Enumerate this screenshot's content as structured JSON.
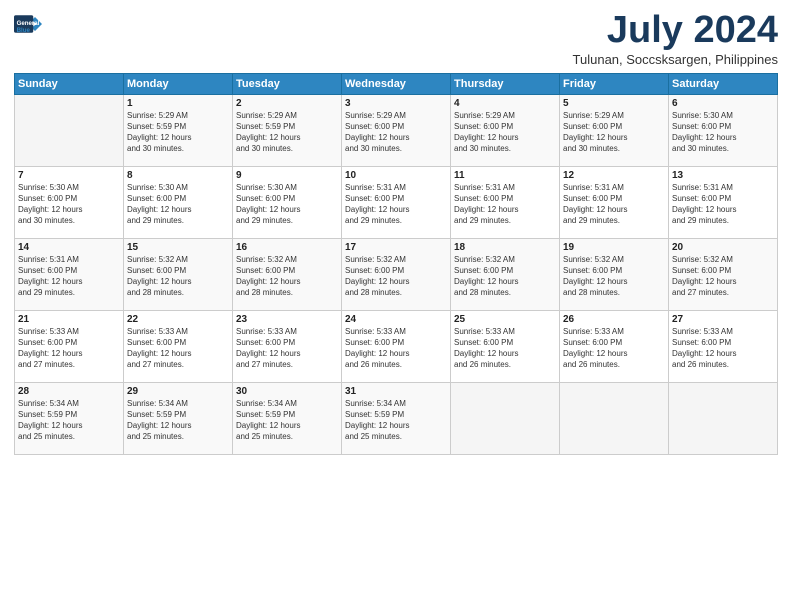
{
  "logo": {
    "line1": "General",
    "line2": "Blue"
  },
  "title": "July 2024",
  "location": "Tulunan, Soccsksargen, Philippines",
  "days_header": [
    "Sunday",
    "Monday",
    "Tuesday",
    "Wednesday",
    "Thursday",
    "Friday",
    "Saturday"
  ],
  "weeks": [
    [
      {
        "day": "",
        "info": ""
      },
      {
        "day": "1",
        "info": "Sunrise: 5:29 AM\nSunset: 5:59 PM\nDaylight: 12 hours\nand 30 minutes."
      },
      {
        "day": "2",
        "info": "Sunrise: 5:29 AM\nSunset: 5:59 PM\nDaylight: 12 hours\nand 30 minutes."
      },
      {
        "day": "3",
        "info": "Sunrise: 5:29 AM\nSunset: 6:00 PM\nDaylight: 12 hours\nand 30 minutes."
      },
      {
        "day": "4",
        "info": "Sunrise: 5:29 AM\nSunset: 6:00 PM\nDaylight: 12 hours\nand 30 minutes."
      },
      {
        "day": "5",
        "info": "Sunrise: 5:29 AM\nSunset: 6:00 PM\nDaylight: 12 hours\nand 30 minutes."
      },
      {
        "day": "6",
        "info": "Sunrise: 5:30 AM\nSunset: 6:00 PM\nDaylight: 12 hours\nand 30 minutes."
      }
    ],
    [
      {
        "day": "7",
        "info": "Sunrise: 5:30 AM\nSunset: 6:00 PM\nDaylight: 12 hours\nand 30 minutes."
      },
      {
        "day": "8",
        "info": "Sunrise: 5:30 AM\nSunset: 6:00 PM\nDaylight: 12 hours\nand 29 minutes."
      },
      {
        "day": "9",
        "info": "Sunrise: 5:30 AM\nSunset: 6:00 PM\nDaylight: 12 hours\nand 29 minutes."
      },
      {
        "day": "10",
        "info": "Sunrise: 5:31 AM\nSunset: 6:00 PM\nDaylight: 12 hours\nand 29 minutes."
      },
      {
        "day": "11",
        "info": "Sunrise: 5:31 AM\nSunset: 6:00 PM\nDaylight: 12 hours\nand 29 minutes."
      },
      {
        "day": "12",
        "info": "Sunrise: 5:31 AM\nSunset: 6:00 PM\nDaylight: 12 hours\nand 29 minutes."
      },
      {
        "day": "13",
        "info": "Sunrise: 5:31 AM\nSunset: 6:00 PM\nDaylight: 12 hours\nand 29 minutes."
      }
    ],
    [
      {
        "day": "14",
        "info": "Sunrise: 5:31 AM\nSunset: 6:00 PM\nDaylight: 12 hours\nand 29 minutes."
      },
      {
        "day": "15",
        "info": "Sunrise: 5:32 AM\nSunset: 6:00 PM\nDaylight: 12 hours\nand 28 minutes."
      },
      {
        "day": "16",
        "info": "Sunrise: 5:32 AM\nSunset: 6:00 PM\nDaylight: 12 hours\nand 28 minutes."
      },
      {
        "day": "17",
        "info": "Sunrise: 5:32 AM\nSunset: 6:00 PM\nDaylight: 12 hours\nand 28 minutes."
      },
      {
        "day": "18",
        "info": "Sunrise: 5:32 AM\nSunset: 6:00 PM\nDaylight: 12 hours\nand 28 minutes."
      },
      {
        "day": "19",
        "info": "Sunrise: 5:32 AM\nSunset: 6:00 PM\nDaylight: 12 hours\nand 28 minutes."
      },
      {
        "day": "20",
        "info": "Sunrise: 5:32 AM\nSunset: 6:00 PM\nDaylight: 12 hours\nand 27 minutes."
      }
    ],
    [
      {
        "day": "21",
        "info": "Sunrise: 5:33 AM\nSunset: 6:00 PM\nDaylight: 12 hours\nand 27 minutes."
      },
      {
        "day": "22",
        "info": "Sunrise: 5:33 AM\nSunset: 6:00 PM\nDaylight: 12 hours\nand 27 minutes."
      },
      {
        "day": "23",
        "info": "Sunrise: 5:33 AM\nSunset: 6:00 PM\nDaylight: 12 hours\nand 27 minutes."
      },
      {
        "day": "24",
        "info": "Sunrise: 5:33 AM\nSunset: 6:00 PM\nDaylight: 12 hours\nand 26 minutes."
      },
      {
        "day": "25",
        "info": "Sunrise: 5:33 AM\nSunset: 6:00 PM\nDaylight: 12 hours\nand 26 minutes."
      },
      {
        "day": "26",
        "info": "Sunrise: 5:33 AM\nSunset: 6:00 PM\nDaylight: 12 hours\nand 26 minutes."
      },
      {
        "day": "27",
        "info": "Sunrise: 5:33 AM\nSunset: 6:00 PM\nDaylight: 12 hours\nand 26 minutes."
      }
    ],
    [
      {
        "day": "28",
        "info": "Sunrise: 5:34 AM\nSunset: 5:59 PM\nDaylight: 12 hours\nand 25 minutes."
      },
      {
        "day": "29",
        "info": "Sunrise: 5:34 AM\nSunset: 5:59 PM\nDaylight: 12 hours\nand 25 minutes."
      },
      {
        "day": "30",
        "info": "Sunrise: 5:34 AM\nSunset: 5:59 PM\nDaylight: 12 hours\nand 25 minutes."
      },
      {
        "day": "31",
        "info": "Sunrise: 5:34 AM\nSunset: 5:59 PM\nDaylight: 12 hours\nand 25 minutes."
      },
      {
        "day": "",
        "info": ""
      },
      {
        "day": "",
        "info": ""
      },
      {
        "day": "",
        "info": ""
      }
    ]
  ]
}
